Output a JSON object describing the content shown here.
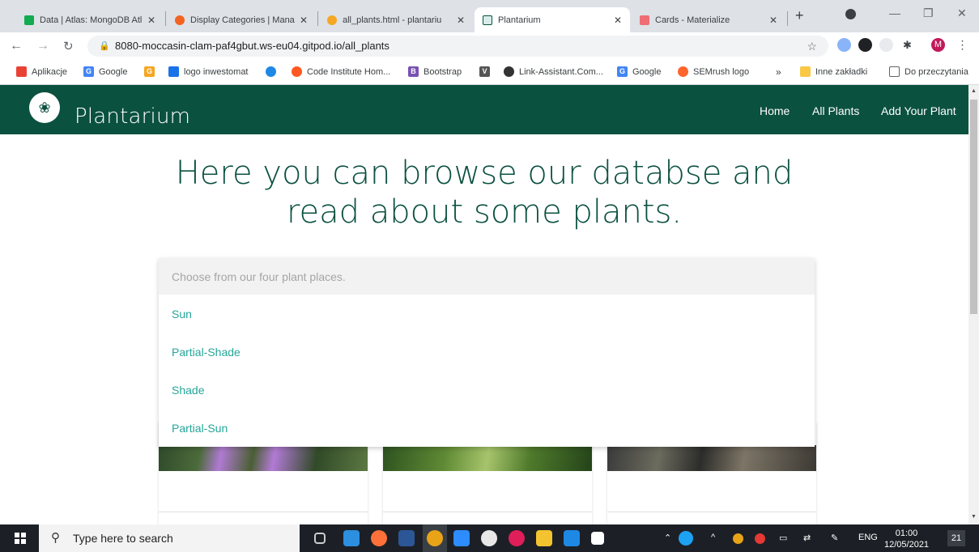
{
  "browser": {
    "tabs": [
      {
        "title": "Data | Atlas: MongoDB Atl",
        "favicon_color": "#13aa52"
      },
      {
        "title": "Display Categories | Mana",
        "favicon_color": "#f26322"
      },
      {
        "title": "all_plants.html - plantariu",
        "favicon_color": "#f5a623"
      },
      {
        "title": "Plantarium",
        "favicon_color": "#0b5140"
      },
      {
        "title": "Cards - Materialize",
        "favicon_color": "#ee6e73"
      }
    ],
    "new_tab": "+",
    "url": "8080-moccasin-clam-paf4gbut.ws-eu04.gitpod.io/all_plants",
    "bookmarks": [
      {
        "label": "Aplikacje",
        "icon": "apps-icon",
        "color": "#e94235"
      },
      {
        "label": "Google",
        "icon": "google-icon",
        "color": "#4285f4"
      },
      {
        "label": "",
        "icon": "orange-g-icon",
        "color": "#f5a623"
      },
      {
        "label": "logo inwestomat",
        "icon": "inwestomat-icon",
        "color": "#1a73e8"
      },
      {
        "label": "",
        "icon": "circle-icon",
        "color": "#1e88e5"
      },
      {
        "label": "Code Institute Hom...",
        "icon": "code-institute-icon",
        "color": "#ff5722"
      },
      {
        "label": "Bootstrap",
        "icon": "bootstrap-icon",
        "color": "#7952b3"
      },
      {
        "label": "",
        "icon": "v-icon",
        "color": "#555555"
      },
      {
        "label": "Link-Assistant.Com...",
        "icon": "link-assistant-icon",
        "color": "#333333"
      },
      {
        "label": "Google",
        "icon": "google-icon",
        "color": "#4285f4"
      },
      {
        "label": "SEMrush logo",
        "icon": "semrush-icon",
        "color": "#ff642d"
      }
    ],
    "more_bookmarks": "»",
    "other_bookmarks": "Inne zakładki",
    "reading_list": "Do przeczytania",
    "avatar_letter": "M"
  },
  "site": {
    "brand": "Plantarium",
    "nav": [
      "Home",
      "All Plants",
      "Add Your Plant"
    ],
    "heading": "Here you can browse our databse and read about some plants.",
    "select": {
      "placeholder": "Choose from our four plant places.",
      "options": [
        "Sun",
        "Partial-Shade",
        "Shade",
        "Partial-Sun"
      ]
    },
    "accent": "#0b5140",
    "option_color": "#26a69a"
  },
  "taskbar": {
    "search_placeholder": "Type here to search",
    "language": "ENG",
    "time": "01:00",
    "date": "12/05/2021",
    "notifications": "21"
  }
}
